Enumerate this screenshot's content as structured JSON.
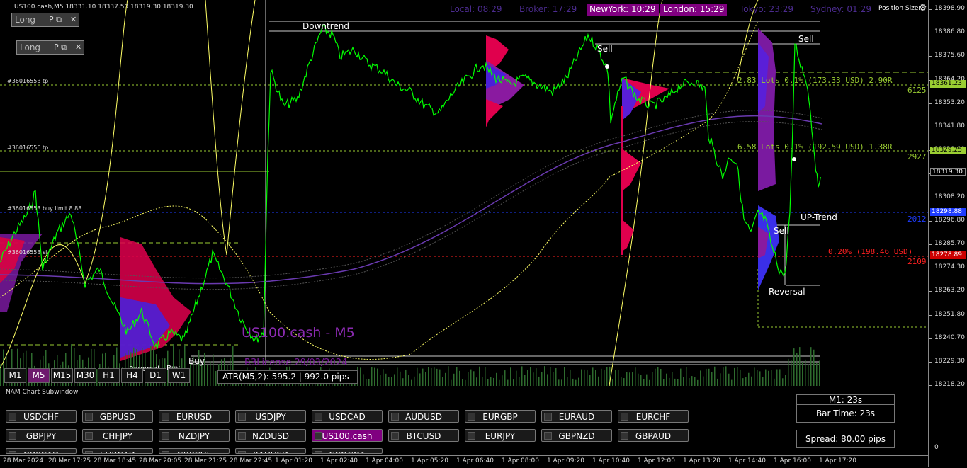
{
  "header": {
    "symbol_info": "US100.cash,M5  18331.10 18337.50 18319.30 18319.30",
    "position_sizer": "Position Sizer",
    "clocks": [
      {
        "label": "Local: 08:29",
        "highlight": false
      },
      {
        "label": "Broker: 17:29",
        "highlight": false
      },
      {
        "label": "NewYork: 10:29",
        "highlight": true
      },
      {
        "label": "London: 15:29",
        "highlight": true
      },
      {
        "label": "Tokyo: 23:29",
        "highlight": false
      },
      {
        "label": "Sydney: 01:29",
        "highlight": false
      }
    ]
  },
  "panels": [
    {
      "label": "Long",
      "sub": "P"
    },
    {
      "label": "Long",
      "sub": "P"
    }
  ],
  "orders": {
    "tp1": "#36016553 tp",
    "tp2": "#36016556 tp",
    "buy_limit": "#36016553 buy limit 8.88",
    "sl": "#36016553 sl"
  },
  "position_labels": {
    "line1": "2.83 Lots 0.1% (173.33 USD) 2.90R",
    "line1_pips": "6125",
    "line2": "6.58 Lots 0.1% (192.59 USD) 1.38R",
    "line2_pips": "2927",
    "entry_pips": "2012",
    "sl_line": "0.20% (198.46 USD)",
    "sl_pips": "2109"
  },
  "annotations": {
    "downtrend": "Downtrend",
    "sell1": "Sell",
    "sell2": "Sell",
    "sell3": "Sell",
    "uptrend": "UP-Trend",
    "reversal": "Reversal",
    "buy": "Buy",
    "small_left": "Reversal",
    "small_buy": "Buy",
    "watermark_symbol": "US100.cash - M5",
    "watermark_license": "R3License 29/03/2024",
    "atr": "ATR(M5,2): 595.2  |  992.0 pips"
  },
  "timeframes": [
    {
      "label": "M1",
      "active": false
    },
    {
      "label": "M5",
      "active": true
    },
    {
      "label": "M15",
      "active": false
    },
    {
      "label": "M30",
      "active": false
    },
    {
      "label": "H1",
      "active": false
    },
    {
      "label": "H4",
      "active": false
    },
    {
      "label": "D1",
      "active": false
    },
    {
      "label": "W1",
      "active": false
    }
  ],
  "price_axis": {
    "labels": [
      "18398.90",
      "18386.80",
      "18375.60",
      "18364.20",
      "18353.20",
      "18341.80",
      "18330.40",
      "18319.30",
      "18308.20",
      "18296.80",
      "18285.70",
      "18274.30",
      "18263.20",
      "18251.80",
      "18240.70",
      "18229.30",
      "18218.20"
    ],
    "tags": [
      {
        "text": "18361.23",
        "color": "#9acd32",
        "text_color": "#000"
      },
      {
        "text": "18329.25",
        "color": "#9acd32",
        "text_color": "#000"
      },
      {
        "text": "18319.30",
        "color": "#000000",
        "text_color": "#fff"
      },
      {
        "text": "18298.88",
        "color": "#1e3cff",
        "text_color": "#fff"
      },
      {
        "text": "18278.89",
        "color": "#cc0000",
        "text_color": "#fff"
      }
    ],
    "sub_top": "",
    "sub_bottom": "0"
  },
  "time_axis": [
    "28 Mar 2024",
    "28 Mar 17:25",
    "28 Mar 18:45",
    "28 Mar 20:05",
    "28 Mar 21:25",
    "28 Mar 22:45",
    "1 Apr 01:20",
    "1 Apr 02:40",
    "1 Apr 04:00",
    "1 Apr 05:20",
    "1 Apr 06:40",
    "1 Apr 08:00",
    "1 Apr 09:20",
    "1 Apr 10:40",
    "1 Apr 12:00",
    "1 Apr 13:20",
    "1 Apr 14:40",
    "1 Apr 16:00",
    "1 Apr 17:20"
  ],
  "subwindow": {
    "title": "NAM Chart Subwindow",
    "symbols_row1": [
      "USDCHF",
      "GBPUSD",
      "EURUSD",
      "USDJPY",
      "USDCAD",
      "AUDUSD",
      "EURGBP",
      "EURAUD",
      "EURCHF"
    ],
    "symbols_row2": [
      "GBPJPY",
      "CHFJPY",
      "NZDJPY",
      "NZDUSD",
      "US100.cash",
      "BTCUSD",
      "EURJPY",
      "GBPNZD",
      "GBPAUD"
    ],
    "symbols_row3": [
      "GBPCAD",
      "EURCAD",
      "GBPCHF",
      "XAUUSD",
      "CCOCOA"
    ],
    "active_symbol": "US100.cash",
    "info_m1": "M1:  23s",
    "info_bar": "Bar Time: 23s",
    "info_spread": "Spread: 80.00 pips"
  },
  "colors": {
    "price_line": "#00ff00",
    "ma_yellow": "#ffff66",
    "tp_line": "#9acd32",
    "entry_line": "#1e3cff",
    "sl_line": "#ff2020",
    "active": "#800080"
  }
}
